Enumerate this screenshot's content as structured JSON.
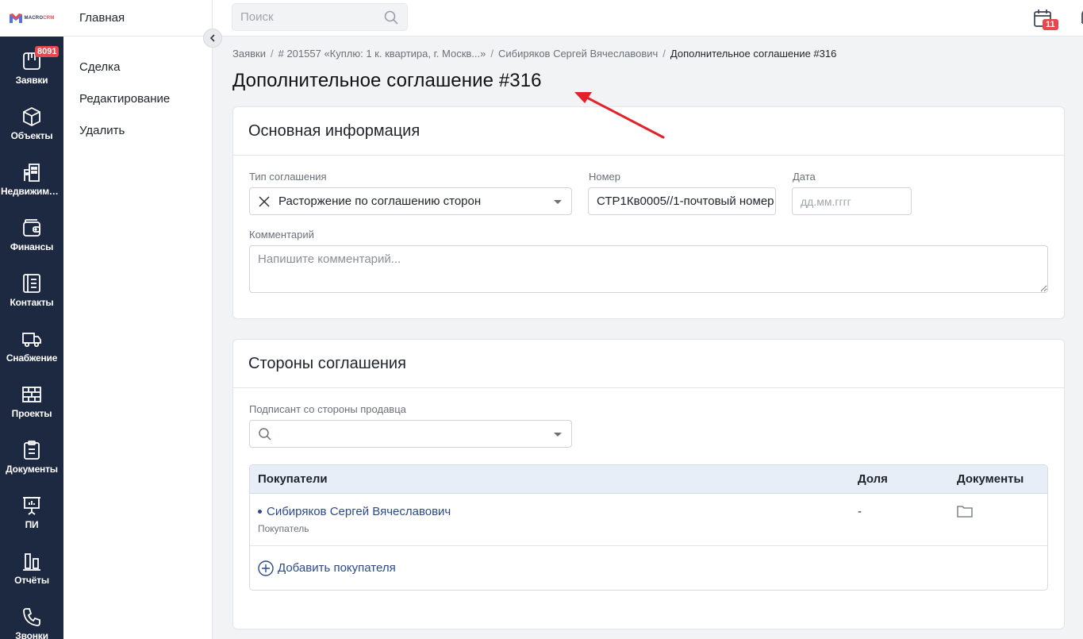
{
  "brand": {
    "logo_main": "MACRO",
    "logo_accent": "CRM"
  },
  "nav": {
    "items": [
      {
        "label": "Заявки",
        "icon": "requests-icon",
        "badge": "8091"
      },
      {
        "label": "Объекты",
        "icon": "cube-icon"
      },
      {
        "label": "Недвижимость",
        "icon": "building-icon"
      },
      {
        "label": "Финансы",
        "icon": "wallet-icon"
      },
      {
        "label": "Контакты",
        "icon": "contacts-icon"
      },
      {
        "label": "Снабжение",
        "icon": "truck-icon"
      },
      {
        "label": "Проекты",
        "icon": "brick-wall-icon"
      },
      {
        "label": "Документы",
        "icon": "clipboard-icon"
      },
      {
        "label": "ПИ",
        "icon": "presentation-icon"
      },
      {
        "label": "Отчёты",
        "icon": "bar-chart-icon"
      },
      {
        "label": "Звонки",
        "icon": "phone-icon"
      }
    ]
  },
  "sidebar": {
    "title": "Главная",
    "items": [
      "Сделка",
      "Редактирование",
      "Удалить"
    ]
  },
  "topbar": {
    "search_placeholder": "Поиск",
    "calendar_badge": "11"
  },
  "breadcrumbs": {
    "items": [
      "Заявки",
      "# 201557 «Куплю: 1 к. квартира, г. Москв...»",
      "Сибиряков Сергей Вячеславович"
    ],
    "current": "Дополнительное соглашение #316",
    "separator": "/"
  },
  "page": {
    "title": "Дополнительное соглашение #316"
  },
  "main_info": {
    "title": "Основная информация",
    "type_label": "Тип соглашения",
    "type_value": "Расторжение по соглашению сторон",
    "number_label": "Номер",
    "number_value": "СТР1Кв0005//1-почтовый номер",
    "date_label": "Дата",
    "date_placeholder": "дд.мм.гггг",
    "comment_label": "Комментарий",
    "comment_placeholder": "Напишите комментарий..."
  },
  "parties": {
    "title": "Стороны соглашения",
    "seller_label": "Подписант со стороны продавца",
    "table": {
      "headers": [
        "Покупатели",
        "Доля",
        "Документы"
      ],
      "rows": [
        {
          "name": "Сибиряков Сергей Вячеславович",
          "role": "Покупатель",
          "share": "-",
          "docs_icon": "folder-icon"
        }
      ],
      "add_label": "Добавить покупателя"
    }
  },
  "colors": {
    "nav_bg": "#1d2940",
    "badge": "#e5484d",
    "link": "#2b4a8b",
    "arrow": "#e3212b"
  }
}
